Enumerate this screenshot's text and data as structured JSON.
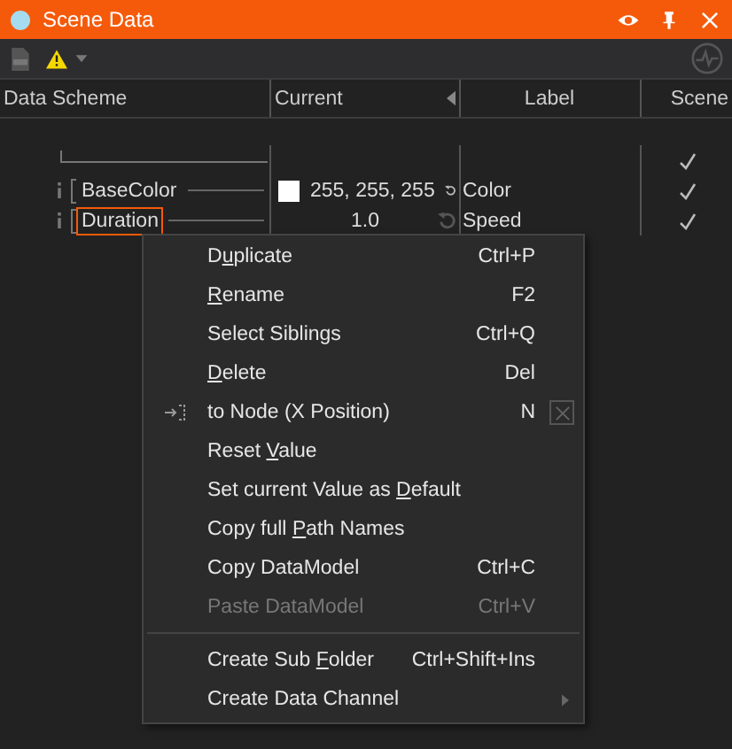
{
  "window": {
    "title": "Scene Data"
  },
  "toolbar": {
    "warning": true
  },
  "table": {
    "columns": [
      "Data Scheme",
      "Current",
      "Label",
      "Scene"
    ],
    "rows": [
      {
        "kind": "group",
        "scene": true
      },
      {
        "kind": "item",
        "name": "BaseColor",
        "color": "#ffffff",
        "value": "255, 255, 255",
        "label": "Color",
        "scene": true,
        "selected": false
      },
      {
        "kind": "item",
        "name": "Duration",
        "value": "1.0",
        "label": "Speed",
        "scene": true,
        "selected": true
      }
    ]
  },
  "context_menu": {
    "items": [
      {
        "kind": "item",
        "pre": "D",
        "key": "u",
        "post": "plicate",
        "shortcut": "Ctrl+P",
        "disabled": false
      },
      {
        "kind": "item",
        "key": "R",
        "post": "ename",
        "shortcut": "F2",
        "disabled": false
      },
      {
        "kind": "item",
        "pre": "Select Siblings",
        "shortcut": "Ctrl+Q",
        "disabled": false
      },
      {
        "kind": "item",
        "key": "D",
        "post": "elete",
        "shortcut": "Del",
        "disabled": false
      },
      {
        "kind": "node",
        "pre": "to Node (X Position)",
        "shortcut": "N",
        "disabled": false
      },
      {
        "kind": "item",
        "pre": "Reset ",
        "key": "V",
        "post": "alue",
        "disabled": false
      },
      {
        "kind": "item",
        "pre": "Set current Value as ",
        "key": "D",
        "post": "efault",
        "disabled": false
      },
      {
        "kind": "item",
        "pre": "Copy full ",
        "key": "P",
        "post": "ath Names",
        "disabled": false
      },
      {
        "kind": "item",
        "pre": "Copy DataModel",
        "shortcut": "Ctrl+C",
        "disabled": false
      },
      {
        "kind": "item",
        "pre": "Paste DataModel",
        "shortcut": "Ctrl+V",
        "disabled": true
      },
      {
        "kind": "separator"
      },
      {
        "kind": "item",
        "pre": "Create Sub ",
        "key": "F",
        "post": "older",
        "shortcut": "Ctrl+Shift+Ins",
        "disabled": false
      },
      {
        "kind": "submenu",
        "pre": "Create Data Channel",
        "disabled": false
      }
    ]
  }
}
